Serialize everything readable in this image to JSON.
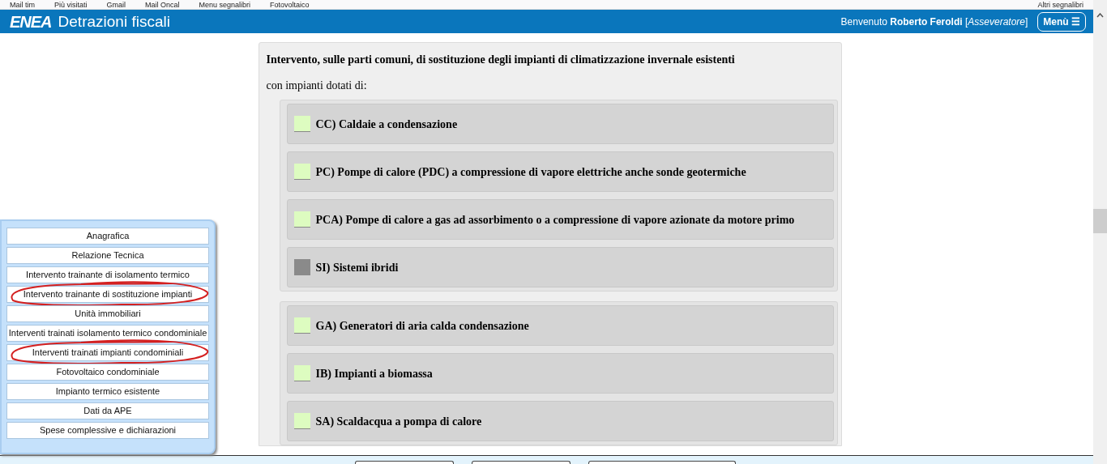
{
  "bookmarks": [
    "Mail tim",
    "Più visitati",
    "Gmail",
    "Mail Oncal",
    "Menu segnalibri",
    "Fotovoltaico"
  ],
  "other_bookmarks": "Altri segnalibri",
  "header": {
    "logo": "ENEA",
    "title": "Detrazioni fiscali",
    "welcome": "Benvenuto **Roberto Feroldi** [*Asseveratore*]",
    "menu_button": "Menù ☰"
  },
  "sidebar": {
    "items": [
      {
        "label": "Anagrafica",
        "annotated": false
      },
      {
        "label": "Relazione Tecnica",
        "annotated": false
      },
      {
        "label": "Intervento trainante di isolamento termico",
        "annotated": false
      },
      {
        "label": "Intervento trainante di sostituzione impianti",
        "annotated": true
      },
      {
        "label": "Unità immobiliari",
        "annotated": false
      },
      {
        "label": "Interventi trainati isolamento termico condominiale",
        "annotated": false
      },
      {
        "label": "Interventi trainati impianti condominiali",
        "annotated": true
      },
      {
        "label": "Fotovoltaico condominiale",
        "annotated": false
      },
      {
        "label": "Impianto termico esistente",
        "annotated": false
      },
      {
        "label": "Dati da APE",
        "annotated": false
      },
      {
        "label": "Spese complessive e dichiarazioni",
        "annotated": false
      }
    ]
  },
  "form": {
    "title": "Intervento, sulle parti comuni, di sostituzione degli impianti di climatizzazione invernale esistenti",
    "subtitle": "con impianti dotati di:",
    "groups": [
      {
        "options": [
          {
            "label": "CC) Caldaie a condensazione",
            "disabled": false
          },
          {
            "label": "PC) Pompe di calore (PDC) a compressione di vapore elettriche anche sonde geotermiche",
            "disabled": false
          },
          {
            "label": "PCA) Pompe di calore a gas ad assorbimento o a compressione di vapore azionate da motore primo",
            "disabled": false
          },
          {
            "label": "SI) Sistemi ibridi",
            "disabled": true
          }
        ]
      },
      {
        "options": [
          {
            "label": "GA) Generatori di aria calda condensazione",
            "disabled": false
          },
          {
            "label": "IB) Impianti a biomassa",
            "disabled": false
          },
          {
            "label": "SA) Scaldacqua a pompa di calore",
            "disabled": false
          }
        ]
      }
    ]
  }
}
